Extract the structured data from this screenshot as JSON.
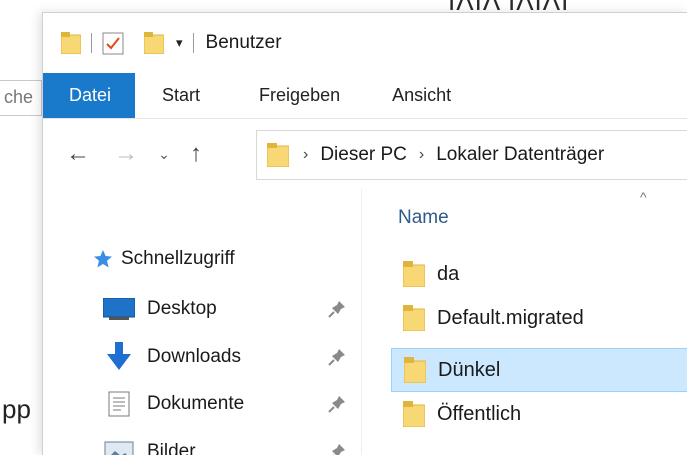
{
  "background": {
    "left_search_fragment": "che",
    "left_text_fragment": "pp"
  },
  "window": {
    "title": "Benutzer"
  },
  "ribbon": {
    "tabs": [
      {
        "label": "Datei",
        "active": true
      },
      {
        "label": "Start"
      },
      {
        "label": "Freigeben"
      },
      {
        "label": "Ansicht"
      }
    ]
  },
  "navigation": {
    "back": "←",
    "forward": "→",
    "recent": "⌄",
    "up": "↑"
  },
  "address": {
    "separator": "›",
    "crumbs": [
      "Dieser PC",
      "Lokaler Datenträger"
    ]
  },
  "navpane": {
    "quick_access": "Schnellzugriff",
    "items": [
      {
        "label": "Desktop",
        "pinned": true
      },
      {
        "label": "Downloads",
        "pinned": true
      },
      {
        "label": "Dokumente",
        "pinned": true
      },
      {
        "label": "Bilder",
        "pinned": true
      }
    ]
  },
  "filelist": {
    "column_name": "Name",
    "sort_indicator": "^",
    "rows": [
      {
        "name": "da",
        "selected": false
      },
      {
        "name": "Default.migrated",
        "selected": false
      },
      {
        "name": "Dünkel",
        "selected": true
      },
      {
        "name": "Öffentlich",
        "selected": false
      }
    ]
  },
  "colors": {
    "file_tab": "#1979ca",
    "folder": "#f8d775",
    "folder_dark": "#e0b53c",
    "selection": "#cce8ff",
    "selection_border": "#99d1ff",
    "star": "#3a8ee6",
    "download_arrow": "#1e6fd1"
  }
}
